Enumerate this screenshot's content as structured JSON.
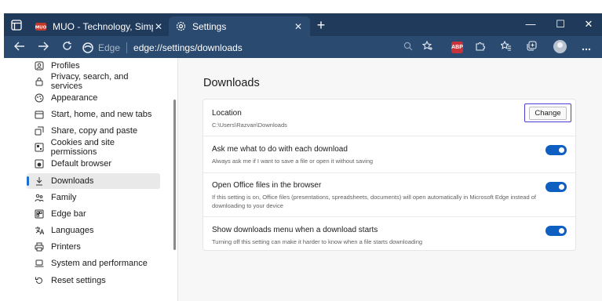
{
  "browser": {
    "tabs": [
      {
        "label": "MUO - Technology, Simplified.",
        "favicon": "muo-favicon-icon"
      },
      {
        "label": "Settings",
        "favicon": "gear-icon"
      }
    ],
    "close_glyph": "✕",
    "new_tab_glyph": "+",
    "window_controls": {
      "minimize": "—",
      "maximize": "☐",
      "close": "✕"
    },
    "address": {
      "brand": "Edge",
      "url_host": "edge://",
      "url_bold": "settings",
      "url_path": "/downloads"
    },
    "extension_badge": "ABP",
    "colors": {
      "titlebar": "#1f3a5b",
      "toolbar": "#2a4a70",
      "accent": "#0f5ec1"
    }
  },
  "sidebar": {
    "items": [
      {
        "label": "Profiles",
        "icon": "profiles-icon"
      },
      {
        "label": "Privacy, search, and services",
        "icon": "lock-icon"
      },
      {
        "label": "Appearance",
        "icon": "appearance-icon"
      },
      {
        "label": "Start, home, and new tabs",
        "icon": "power-icon"
      },
      {
        "label": "Share, copy and paste",
        "icon": "share-icon"
      },
      {
        "label": "Cookies and site permissions",
        "icon": "cookies-icon"
      },
      {
        "label": "Default browser",
        "icon": "browser-icon"
      },
      {
        "label": "Downloads",
        "icon": "download-icon",
        "active": true
      },
      {
        "label": "Family",
        "icon": "family-icon"
      },
      {
        "label": "Edge bar",
        "icon": "edge-bar-icon"
      },
      {
        "label": "Languages",
        "icon": "languages-icon"
      },
      {
        "label": "Printers",
        "icon": "printer-icon"
      },
      {
        "label": "System and performance",
        "icon": "laptop-icon"
      },
      {
        "label": "Reset settings",
        "icon": "reset-icon"
      }
    ]
  },
  "main": {
    "title": "Downloads",
    "location": {
      "title": "Location",
      "path": "C:\\Users\\Razvan\\Downloads",
      "button": "Change"
    },
    "settings": [
      {
        "title": "Ask me what to do with each download",
        "desc": "Always ask me if I want to save a file or open it without saving",
        "enabled": true
      },
      {
        "title": "Open Office files in the browser",
        "desc": "If this setting is on, Office files (presentations, spreadsheets, documents) will open automatically in Microsoft Edge instead of downloading to your device",
        "enabled": true
      },
      {
        "title": "Show downloads menu when a download starts",
        "desc": "Turning off this setting can make it harder to know when a file starts downloading",
        "enabled": true
      }
    ]
  }
}
